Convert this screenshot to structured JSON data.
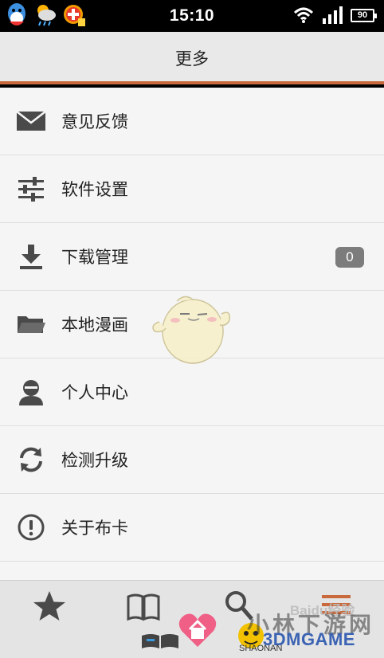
{
  "status_bar": {
    "time": "15:10",
    "battery": "90",
    "left_icons": [
      "qq-icon",
      "weather-icon",
      "app-icon"
    ]
  },
  "header": {
    "title": "更多"
  },
  "menu": {
    "items": [
      {
        "id": "feedback",
        "label": "意见反馈",
        "icon": "mail-icon"
      },
      {
        "id": "settings",
        "label": "软件设置",
        "icon": "sliders-icon"
      },
      {
        "id": "downloads",
        "label": "下载管理",
        "icon": "download-icon",
        "badge": "0"
      },
      {
        "id": "local",
        "label": "本地漫画",
        "icon": "folder-icon"
      },
      {
        "id": "profile",
        "label": "个人中心",
        "icon": "user-icon"
      },
      {
        "id": "update",
        "label": "检测升级",
        "icon": "refresh-icon"
      },
      {
        "id": "about",
        "label": "关于布卡",
        "icon": "info-icon"
      }
    ]
  },
  "bottom_tabs": [
    {
      "name": "favorites",
      "icon": "star-icon"
    },
    {
      "name": "library",
      "icon": "book-icon"
    },
    {
      "name": "search",
      "icon": "search-icon"
    },
    {
      "name": "more",
      "icon": "list-icon"
    }
  ],
  "watermarks": {
    "baidu": "Baidu经验",
    "site": "小林下游网",
    "game": "3DMGAME",
    "shaonan": "SHAONAN"
  },
  "colors": {
    "accent": "#c86a3d",
    "background": "#f5f5f5",
    "header_bg": "#e9e9e9",
    "icon": "#4a4a4a",
    "badge": "#7c7c7c"
  }
}
